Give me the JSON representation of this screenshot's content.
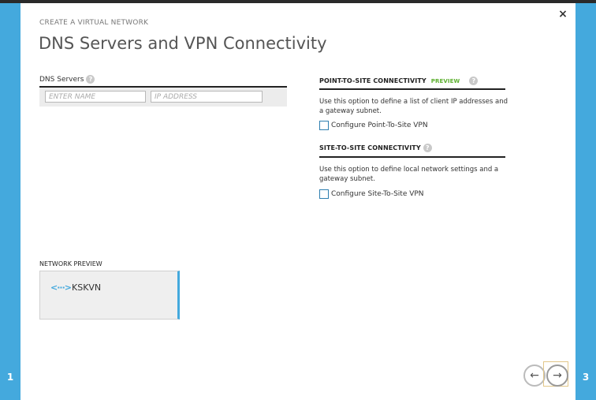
{
  "wizard": {
    "eyebrow": "CREATE A VIRTUAL NETWORK",
    "title": "DNS Servers and VPN Connectivity",
    "close_glyph": "×",
    "left_step": "1",
    "right_step": "3"
  },
  "dns": {
    "label": "DNS Servers",
    "name_placeholder": "ENTER NAME",
    "ip_placeholder": "IP ADDRESS"
  },
  "point_to_site": {
    "heading": "POINT-TO-SITE CONNECTIVITY",
    "badge": "PREVIEW",
    "description": "Use this option to define a list of client IP addresses and a gateway subnet.",
    "checkbox_label": "Configure Point-To-Site VPN",
    "checked": false
  },
  "site_to_site": {
    "heading": "SITE-TO-SITE CONNECTIVITY",
    "description": "Use this option to define local network settings and a gateway subnet.",
    "checkbox_label": "Configure Site-To-Site VPN",
    "checked": false
  },
  "network_preview": {
    "label": "NETWORK PREVIEW",
    "icon_glyph": "<···>",
    "network_name": "KSKVN"
  },
  "nav": {
    "prev_glyph": "←",
    "next_glyph": "→"
  },
  "colors": {
    "accent": "#44a9dd",
    "preview_badge": "#5db02f"
  }
}
